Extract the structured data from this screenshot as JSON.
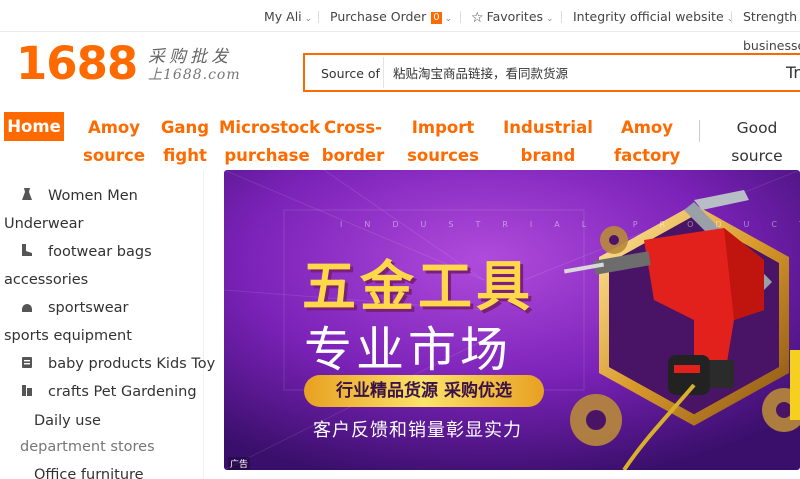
{
  "topbar": {
    "my_ali": "My Ali",
    "purchase_order": "Purchase Order",
    "order_count": "0",
    "favorites": "Favorites",
    "integrity": "Integrity official website",
    "strength": "Strength",
    "strength_sub": "businesses"
  },
  "logo": {
    "number": "1688",
    "tagline_cn": "采购批发",
    "url": "上1688.com"
  },
  "search": {
    "source_label": "Source of",
    "placeholder": "粘贴淘宝商品链接，看同款货源",
    "trailing": "Tr"
  },
  "nav": {
    "home": "Home",
    "items": [
      {
        "line1": "Amoy",
        "line2": "source"
      },
      {
        "line1": "Gang",
        "line2": "fight"
      },
      {
        "line1": "Microstock",
        "line2": "purchase"
      },
      {
        "line1": "Cross-",
        "line2": "border"
      },
      {
        "line1": "Import",
        "line2": "sources"
      },
      {
        "line1": "Industrial",
        "line2": "brand station"
      },
      {
        "line1": "Amoy",
        "line2": "factory"
      },
      {
        "line1": "Good",
        "line2": "source"
      }
    ]
  },
  "sidebar": {
    "categories": [
      {
        "line1": "Women Men",
        "line2": "Underwear",
        "icon": "dress-icon"
      },
      {
        "line1": "footwear bags",
        "line2": "accessories",
        "icon": "shoe-icon"
      },
      {
        "line1": "sportswear",
        "line2": "sports equipment",
        "icon": "helmet-icon"
      },
      {
        "line1": "baby products Kids Toy",
        "icon": "baby-icon"
      },
      {
        "line1": "crafts Pet Gardening",
        "line2": "Daily use",
        "line3": "department stores",
        "icon": "craft-icon"
      },
      {
        "line1": "Office  furniture"
      }
    ]
  },
  "banner": {
    "tiny_text": "INDUSTRIAL PRODUCTS",
    "title": "五金工具",
    "subtitle": "专业市场",
    "pill": "行业精品货源 采购优选",
    "footer": "客户反馈和销量彰显实力",
    "ad_tag": "广告"
  },
  "colors": {
    "brand": "#ff6a00",
    "banner_purple": "#7b22b8"
  }
}
